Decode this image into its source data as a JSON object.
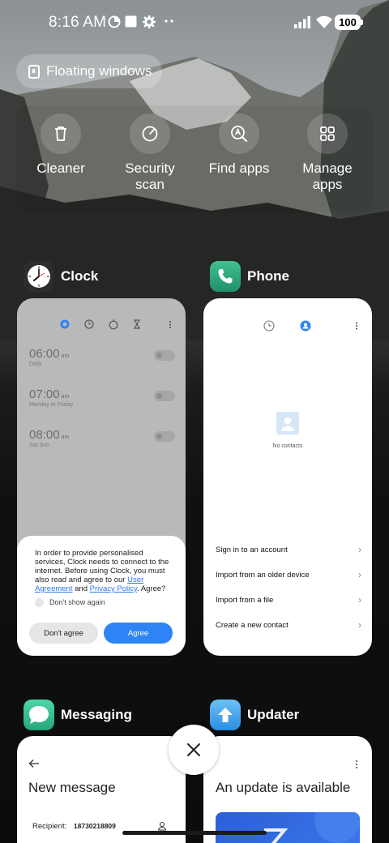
{
  "status_bar": {
    "time": "8:16 AM",
    "battery": "100"
  },
  "floating_windows": {
    "label": "Floating windows"
  },
  "quick_actions": [
    {
      "label": "Cleaner",
      "icon": "trash-icon"
    },
    {
      "label": "Security scan",
      "icon": "security-scan-icon"
    },
    {
      "label": "Find apps",
      "icon": "find-apps-icon"
    },
    {
      "label": "Manage apps",
      "icon": "manage-apps-icon"
    }
  ],
  "apps": {
    "clock": {
      "name": "Clock",
      "alarms": [
        {
          "time": "06:00",
          "ampm": "am",
          "days": "Daily"
        },
        {
          "time": "07:00",
          "ampm": "am",
          "days": "Monday to Friday"
        },
        {
          "time": "08:00",
          "ampm": "am",
          "days": "Sat Sun"
        }
      ],
      "dialog": {
        "text_before": "In order to provide personalised services, Clock needs to connect to the internet. Before using Clock, you must also read and agree to our ",
        "link_user_agreement": "User Agreement",
        "and": " and ",
        "link_privacy": "Privacy Policy",
        "text_after": ". Agree?",
        "checkbox_label": "Don't show again",
        "disagree": "Don't agree",
        "agree": "Agree"
      }
    },
    "phone": {
      "name": "Phone",
      "empty_text": "No contacts",
      "rows": [
        "Sign in to an account",
        "Import from an older device",
        "Import from a file",
        "Create a new contact"
      ]
    },
    "messaging": {
      "name": "Messaging",
      "title": "New message",
      "recipient_label": "Recipient:",
      "recipient_value": "18730218809"
    },
    "updater": {
      "name": "Updater",
      "title": "An update is available"
    }
  },
  "colors": {
    "accent_blue": "#2f84f5",
    "link_blue": "#2f77ed"
  }
}
